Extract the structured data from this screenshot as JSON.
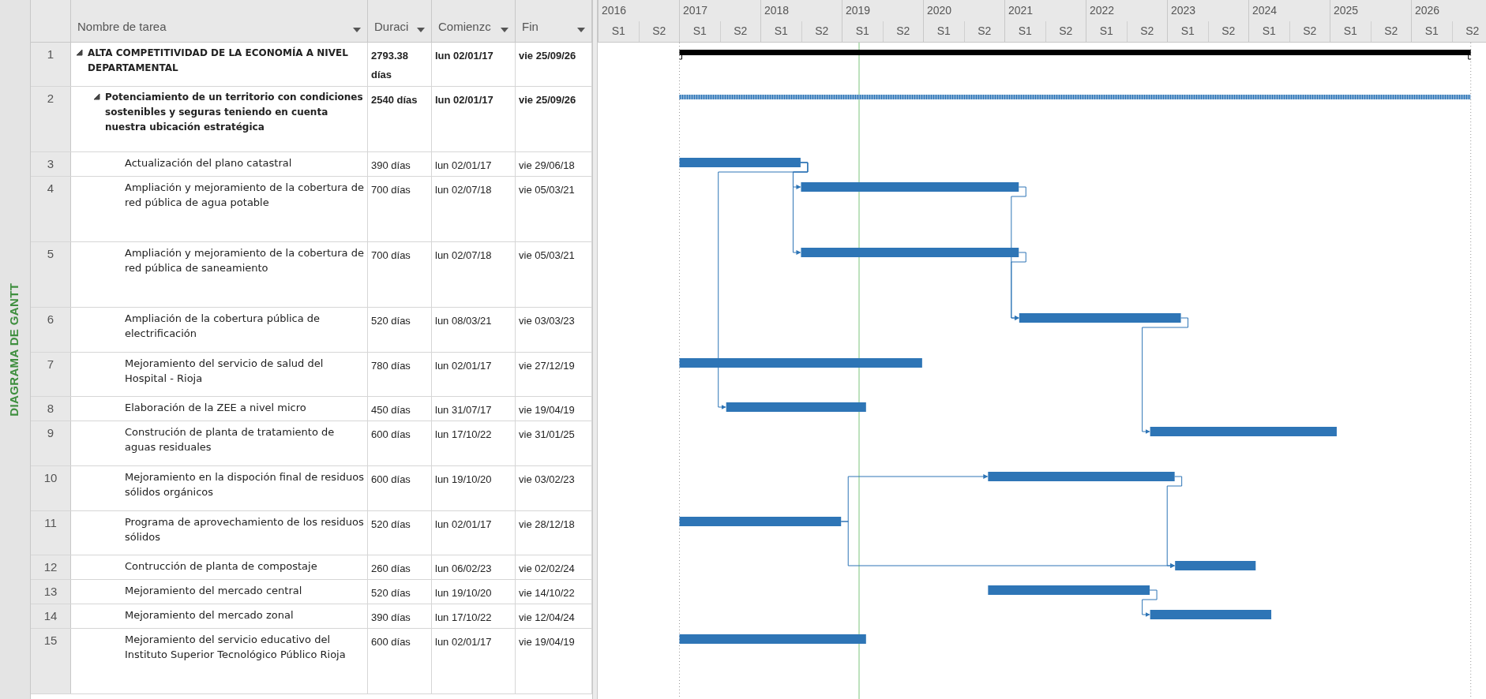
{
  "side_label": "DIAGRAMA DE GANTT",
  "table": {
    "columns": [
      {
        "label": "Nombre de tarea"
      },
      {
        "label": "Duraci"
      },
      {
        "label": "Comienzc"
      },
      {
        "label": "Fin"
      }
    ],
    "tasks": [
      {
        "row_number": "1",
        "name": "ALTA COMPETITIVIDAD DE LA ECONOMÍA A NIVEL DEPARTAMENTAL",
        "duration": "2793.38 días",
        "start": "lun 02/01/17",
        "finish": "vie 25/09/26",
        "expanded": true,
        "children": [
          {
            "row_number": "2",
            "name": "Potenciamiento de un territorio con condiciones sostenibles y seguras teniendo en cuenta nuestra ubicación estratégica",
            "duration": "2540 días",
            "start": "lun 02/01/17",
            "finish": "vie 25/09/26",
            "expanded": true,
            "children": [
              {
                "row_number": "3",
                "name": "Actualización del plano catastral",
                "duration": "390 días",
                "start": "lun 02/01/17",
                "finish": "vie 29/06/18"
              },
              {
                "row_number": "4",
                "name": "Ampliación y mejoramiento de la cobertura de red pública de agua potable",
                "duration": "700 días",
                "start": "lun 02/07/18",
                "finish": "vie 05/03/21"
              },
              {
                "row_number": "5",
                "name": "Ampliación y mejoramiento de la cobertura de red pública de saneamiento",
                "duration": "700 días",
                "start": "lun 02/07/18",
                "finish": "vie 05/03/21"
              },
              {
                "row_number": "6",
                "name": "Ampliación de la cobertura pública de electrificación",
                "duration": "520 días",
                "start": "lun 08/03/21",
                "finish": "vie 03/03/23"
              },
              {
                "row_number": "7",
                "name": "Mejoramiento del servicio de salud del Hospital - Rioja",
                "duration": "780 días",
                "start": "lun 02/01/17",
                "finish": "vie 27/12/19"
              },
              {
                "row_number": "8",
                "name": "Elaboración de la ZEE a nivel micro",
                "duration": "450 días",
                "start": "lun 31/07/17",
                "finish": "vie 19/04/19"
              },
              {
                "row_number": "9",
                "name": "Construción de planta de tratamiento de aguas residuales",
                "duration": "600 días",
                "start": "lun 17/10/22",
                "finish": "vie 31/01/25"
              },
              {
                "row_number": "10",
                "name": "Mejoramiento en la dispoción final de residuos sólidos orgánicos",
                "duration": "600 días",
                "start": "lun 19/10/20",
                "finish": "vie 03/02/23"
              },
              {
                "row_number": "11",
                "name": "Programa de aprovechamiento de los residuos sólidos",
                "duration": "520 días",
                "start": "lun 02/01/17",
                "finish": "vie 28/12/18"
              },
              {
                "row_number": "12",
                "name": "Contrucción de planta de compostaje",
                "duration": "260 días",
                "start": "lun 06/02/23",
                "finish": "vie 02/02/24"
              },
              {
                "row_number": "13",
                "name": "Mejoramiento del mercado central",
                "duration": "520 días",
                "start": "lun 19/10/20",
                "finish": "vie 14/10/22"
              },
              {
                "row_number": "14",
                "name": "Mejoramiento del mercado zonal",
                "duration": "390 días",
                "start": "lun 17/10/22",
                "finish": "vie 12/04/24"
              },
              {
                "row_number": "15",
                "name": "Mejoramiento del servicio educativo del Instituto Superior Tecnológico Público Rioja",
                "duration": "600 días",
                "start": "lun 02/01/17",
                "finish": "vie 19/04/19"
              }
            ]
          }
        ]
      }
    ]
  },
  "timeline": {
    "years": [
      {
        "year": "2016",
        "halves": [
          "S1",
          "S2"
        ]
      },
      {
        "year": "2017",
        "halves": [
          "S1",
          "S2"
        ]
      },
      {
        "year": "2018",
        "halves": [
          "S1",
          "S2"
        ]
      },
      {
        "year": "2019",
        "halves": [
          "S1",
          "S2"
        ]
      },
      {
        "year": "2020",
        "halves": [
          "S1",
          "S2"
        ]
      },
      {
        "year": "2021",
        "halves": [
          "S1",
          "S2"
        ]
      },
      {
        "year": "2022",
        "halves": [
          "S1",
          "S2"
        ]
      },
      {
        "year": "2023",
        "halves": [
          "S1",
          "S2"
        ]
      },
      {
        "year": "2024",
        "halves": [
          "S1",
          "S2"
        ]
      },
      {
        "year": "2025",
        "halves": [
          "S1",
          "S2"
        ]
      },
      {
        "year": "2026",
        "halves": [
          "S1",
          "S2"
        ]
      }
    ]
  }
}
